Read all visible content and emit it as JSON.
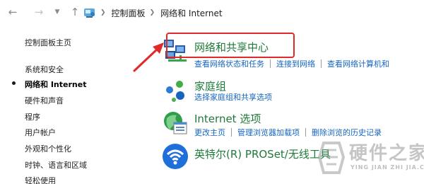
{
  "breadcrumb": {
    "items": [
      "控制面板",
      "网络和 Internet"
    ]
  },
  "sidebar": {
    "home": "控制面板主页",
    "items": [
      {
        "label": "系统和安全",
        "current": false
      },
      {
        "label": "网络和 Internet",
        "current": true
      },
      {
        "label": "硬件和声音",
        "current": false
      },
      {
        "label": "程序",
        "current": false
      },
      {
        "label": "用户帐户",
        "current": false
      },
      {
        "label": "外观和个性化",
        "current": false
      },
      {
        "label": "时钟、语言和区域",
        "current": false
      },
      {
        "label": "轻松使用",
        "current": false
      }
    ]
  },
  "categories": [
    {
      "title": "网络和共享中心",
      "icon": "network-sharing-center-icon",
      "links": [
        "查看网络状态和任务",
        "连接到网络",
        "查看网络计算机和"
      ]
    },
    {
      "title": "家庭组",
      "icon": "homegroup-icon",
      "links": [
        "选择家庭组和共享选项"
      ]
    },
    {
      "title": "Internet 选项",
      "icon": "internet-options-icon",
      "links": [
        "更改主页",
        "管理浏览器加载项",
        "删除浏览的历史记录"
      ]
    },
    {
      "title": "英特尔(R) PROSet/无线工具",
      "icon": "intel-proset-wireless-icon",
      "links": []
    }
  ],
  "annotation": {
    "highlight_color": "#e02a2a"
  },
  "watermark": {
    "text": "硬件之家",
    "subtext": "YING JIAN ZHI JIA.COM"
  },
  "colors": {
    "category_title": "#1f7a3a",
    "link": "#1565c0"
  }
}
